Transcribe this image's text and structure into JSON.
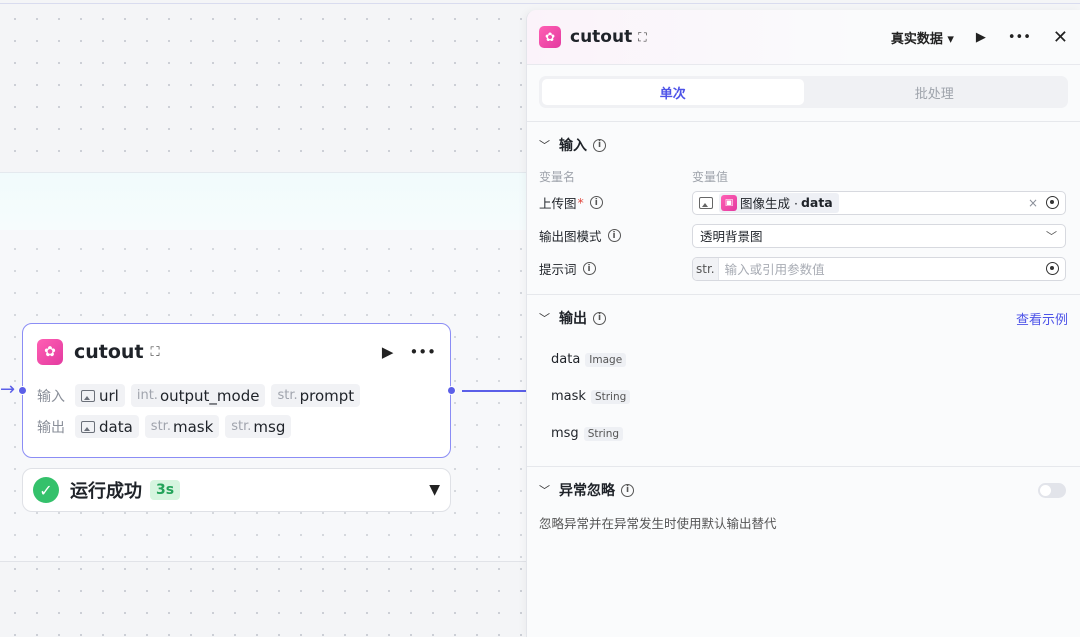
{
  "node": {
    "title": "cutout",
    "input_label": "输入",
    "output_label": "输出",
    "inputs": [
      {
        "type": "",
        "name": "url",
        "image": true
      },
      {
        "type": "int.",
        "name": "output_mode",
        "image": false
      },
      {
        "type": "str.",
        "name": "prompt",
        "image": false
      }
    ],
    "outputs": [
      {
        "type": "",
        "name": "data",
        "image": true
      },
      {
        "type": "str.",
        "name": "mask",
        "image": false
      },
      {
        "type": "str.",
        "name": "msg",
        "image": false
      }
    ]
  },
  "status": {
    "text": "运行成功",
    "duration": "3s"
  },
  "panel": {
    "title": "cutout",
    "mode": "真实数据",
    "tabs": [
      "单次",
      "批处理"
    ],
    "input_section": {
      "title": "输入",
      "col_name": "变量名",
      "col_value": "变量值",
      "fields": {
        "upload": {
          "label": "上传图",
          "required": "*",
          "ref_source": "图像生成 ·",
          "ref_var": "data"
        },
        "output_mode": {
          "label": "输出图模式",
          "value": "透明背景图"
        },
        "prompt": {
          "label": "提示词",
          "prefix": "str.",
          "placeholder": "输入或引用参数值"
        }
      }
    },
    "output_section": {
      "title": "输出",
      "link": "查看示例",
      "items": [
        {
          "name": "data",
          "type": "Image"
        },
        {
          "name": "mask",
          "type": "String"
        },
        {
          "name": "msg",
          "type": "String"
        }
      ]
    },
    "exception_section": {
      "title": "异常忽略",
      "description": "忽略异常并在异常发生时使用默认输出替代",
      "enabled": false
    }
  },
  "colors": {
    "accent": "#4d53e8",
    "edge": "#5b5fe8",
    "success": "#34c16b",
    "logo": "#e33aa0"
  }
}
